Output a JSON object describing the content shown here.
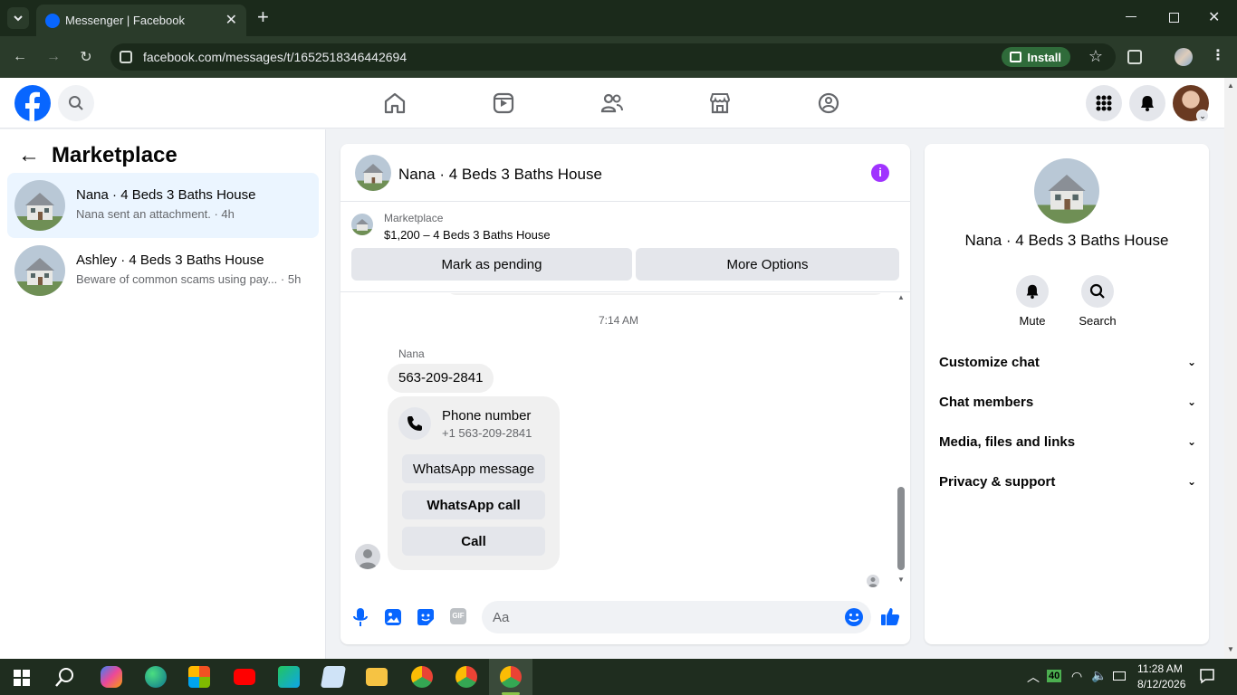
{
  "browser": {
    "tab_title": "Messenger | Facebook",
    "url": "facebook.com/messages/t/1652518346442694",
    "install_label": "Install",
    "new_tab_symbol": "+"
  },
  "header": {
    "nav_icons": [
      "home-icon",
      "video-icon",
      "friends-icon",
      "marketplace-icon",
      "groups-icon"
    ]
  },
  "sidebar": {
    "title": "Marketplace",
    "conversations": [
      {
        "title": "Nana · 4 Beds 3 Baths House",
        "preview": "Nana sent an attachment.",
        "time": " · 4h"
      },
      {
        "title": "Ashley · 4 Beds 3 Baths House",
        "preview": "Beware of common scams using pay...",
        "time": " · 5h"
      }
    ]
  },
  "chat": {
    "title": "Nana · 4 Beds 3 Baths House",
    "listing_source": "Marketplace",
    "listing_title": "$1,200 – 4 Beds 3 Baths House",
    "mark_pending_label": "Mark as pending",
    "more_options_label": "More Options",
    "timestamp": "7:14 AM",
    "sender_name": "Nana",
    "message_text": "563-209-2841",
    "card": {
      "title": "Phone number",
      "number": "+1 563-209-2841",
      "actions": [
        "WhatsApp message",
        "WhatsApp call",
        "Call"
      ]
    },
    "composer_placeholder": "Aa",
    "gif_label": "GIF"
  },
  "info": {
    "name": "Nana · 4 Beds 3 Baths House",
    "mute_label": "Mute",
    "search_label": "Search",
    "sections": [
      "Customize chat",
      "Chat members",
      "Media, files and links",
      "Privacy & support"
    ]
  },
  "taskbar": {
    "time": "11:28 AM",
    "date": "8/12/2026",
    "badge": "40"
  },
  "colors": {
    "fb_blue": "#0866ff",
    "info_purple": "#a033ff",
    "selected_bg": "#ebf5ff"
  }
}
